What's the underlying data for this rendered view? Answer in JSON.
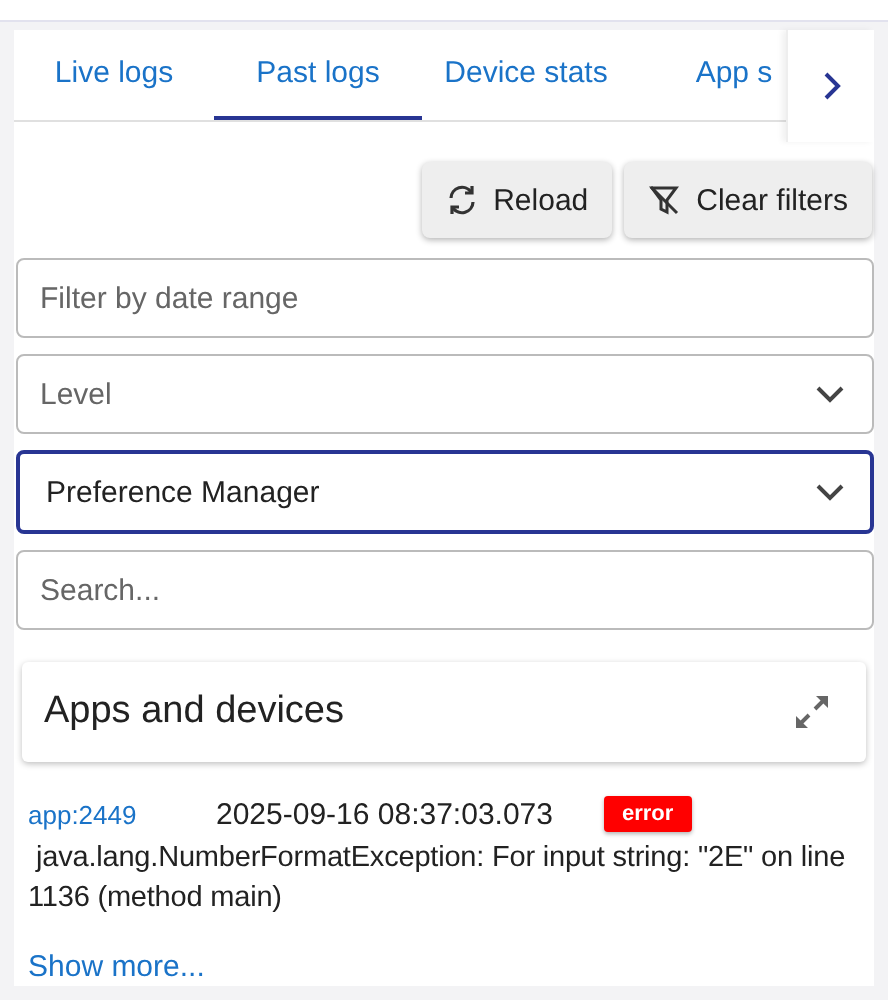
{
  "tabs": [
    {
      "label": "Live logs",
      "selected": false
    },
    {
      "label": "Past logs",
      "selected": true
    },
    {
      "label": "Device stats",
      "selected": false
    },
    {
      "label": "App s",
      "selected": false
    }
  ],
  "toolbar": {
    "buttons": [
      {
        "kind": "reload",
        "label": "Reload"
      },
      {
        "kind": "filter",
        "label": "Clear filters"
      }
    ]
  },
  "filters": [
    {
      "kind": "text",
      "placeholder": "Filter by date range",
      "focused": false
    },
    {
      "kind": "select",
      "placeholder": "Level",
      "focused": false
    },
    {
      "kind": "select",
      "value": "Preference Manager",
      "focused": true
    },
    {
      "kind": "text",
      "placeholder": "Search...",
      "focused": false
    }
  ],
  "panel": {
    "title": "Apps and devices"
  },
  "logs": [
    {
      "source": "app:2449",
      "time": "2025-09-16 08:37:03.073",
      "level": "error",
      "color": "#ff0000",
      "message": "java.lang.NumberFormatException: For input string: \"2E\" on line 1136 (method main)"
    }
  ],
  "show_more": "Show more..."
}
